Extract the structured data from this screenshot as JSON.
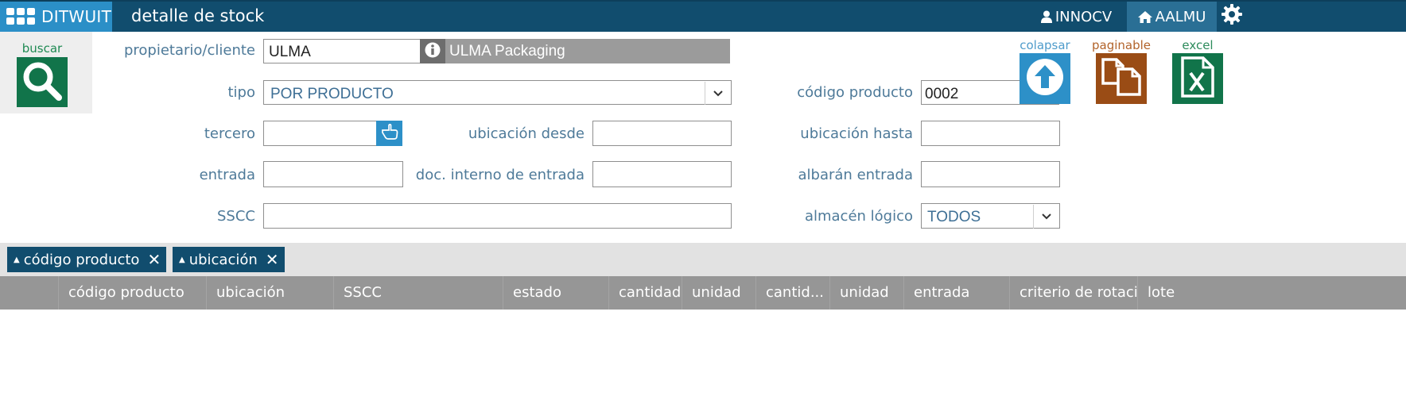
{
  "app": {
    "brand": "DITWUIT",
    "page_title": "detalle de stock"
  },
  "header": {
    "user": "INNOCV",
    "warehouse": "AALMU"
  },
  "icons": {
    "apps": "apps-grid-icon",
    "user": "user-icon",
    "home": "home-icon",
    "settings": "gear-icon",
    "search": "search-icon",
    "info": "info-icon",
    "hand": "hand-pointer-icon",
    "collapse": "arrow-up-circle-icon",
    "paginate": "copy-pages-icon",
    "excel": "excel-icon",
    "close": "close-icon",
    "chevron": "chevron-down-icon"
  },
  "colors": {
    "header": "#114d6e",
    "brand": "#2b8fc7",
    "search": "#11744a",
    "collapse": "#2d90c8",
    "paginate": "#9a4c15",
    "excel": "#11744a"
  },
  "search": {
    "label": "buscar"
  },
  "form": {
    "owner": {
      "label": "propietario/cliente",
      "value": "ULMA",
      "name": "ULMA Packaging"
    },
    "tipo": {
      "label": "tipo",
      "value": "POR PRODUCTO"
    },
    "codigo_producto": {
      "label": "código producto",
      "value": "0002"
    },
    "tercero": {
      "label": "tercero",
      "value": ""
    },
    "ubicacion_desde": {
      "label": "ubicación desde",
      "value": ""
    },
    "ubicacion_hasta": {
      "label": "ubicación hasta",
      "value": ""
    },
    "entrada": {
      "label": "entrada",
      "value": ""
    },
    "doc_interno": {
      "label": "doc. interno de entrada",
      "value": ""
    },
    "albaran": {
      "label": "albarán entrada",
      "value": ""
    },
    "sscc": {
      "label": "SSCC",
      "value": ""
    },
    "almacen": {
      "label": "almacén lógico",
      "value": "TODOS"
    }
  },
  "actions": {
    "collapse": "colapsar",
    "paginate": "paginable",
    "excel": "excel"
  },
  "groups": [
    "código producto",
    "ubicación"
  ],
  "table": {
    "columns": [
      "código producto",
      "ubicación",
      "SSCC",
      "estado",
      "cantidad",
      "unidad",
      "cantid...",
      "unidad",
      "entrada",
      "criterio de rotació",
      "lote"
    ]
  }
}
